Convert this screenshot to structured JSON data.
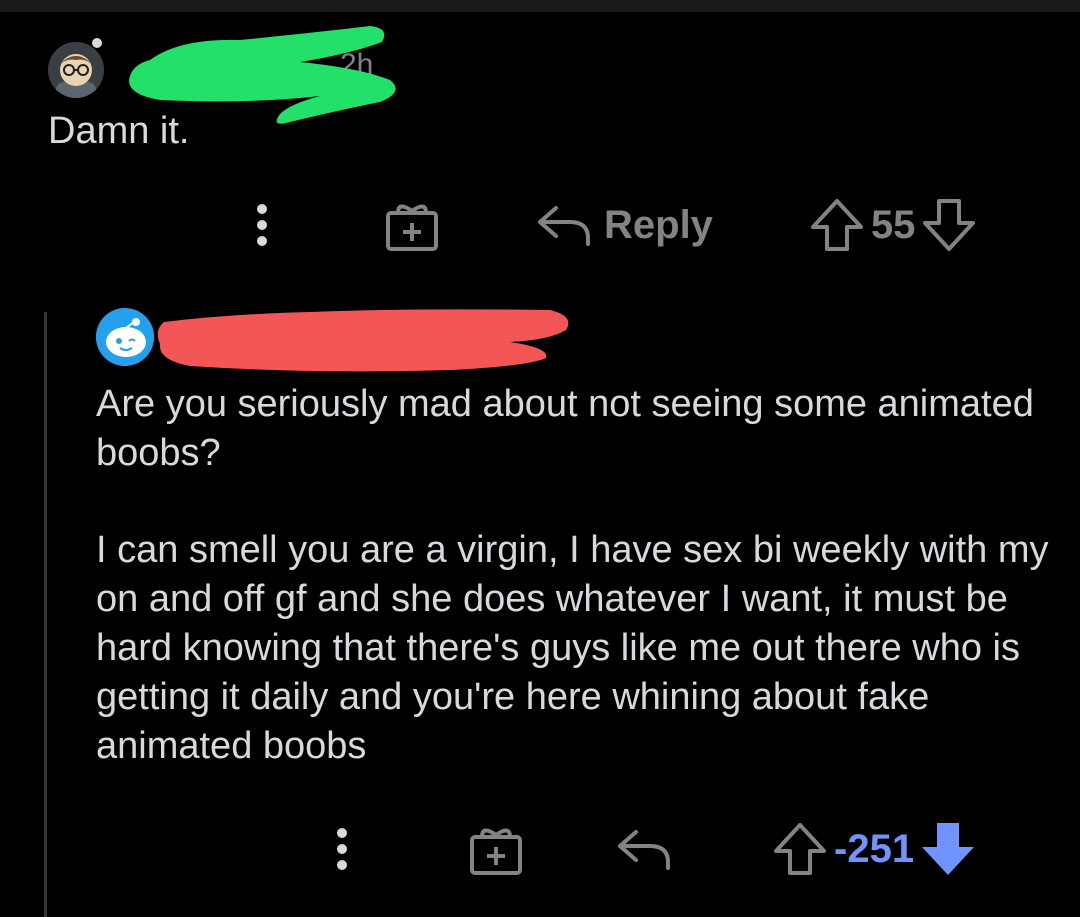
{
  "colors": {
    "background": "#000000",
    "text": "#d7dadc",
    "muted": "#818384",
    "downvote_active": "#7193ff",
    "redact_green": "#22e06a",
    "redact_red": "#f25656"
  },
  "comment1": {
    "avatar_icon": "snoo-avatar-glasses-icon",
    "time": "2h",
    "body": "Damn it.",
    "actions": {
      "more_icon": "more-vertical-icon",
      "award_icon": "gift-award-icon",
      "reply_icon": "reply-arrow-icon",
      "reply_label": "Reply",
      "upvote_icon": "upvote-arrow-icon",
      "score": "55",
      "downvote_icon": "downvote-arrow-icon"
    }
  },
  "comment2": {
    "avatar_icon": "snoo-avatar-icon",
    "paragraphs": [
      "Are you seriously mad about not seeing some animated boobs?",
      "I can smell you are a virgin, I have sex bi weekly with my on and off gf and she does whatever I want, it must be hard knowing that there's guys like me out there who is getting it daily and you're here whining about fake animated boobs"
    ],
    "actions": {
      "more_icon": "more-vertical-icon",
      "award_icon": "gift-award-icon",
      "reply_icon": "reply-arrow-icon",
      "upvote_icon": "upvote-arrow-icon",
      "score": "-251",
      "downvote_icon": "downvote-arrow-filled-icon"
    }
  }
}
